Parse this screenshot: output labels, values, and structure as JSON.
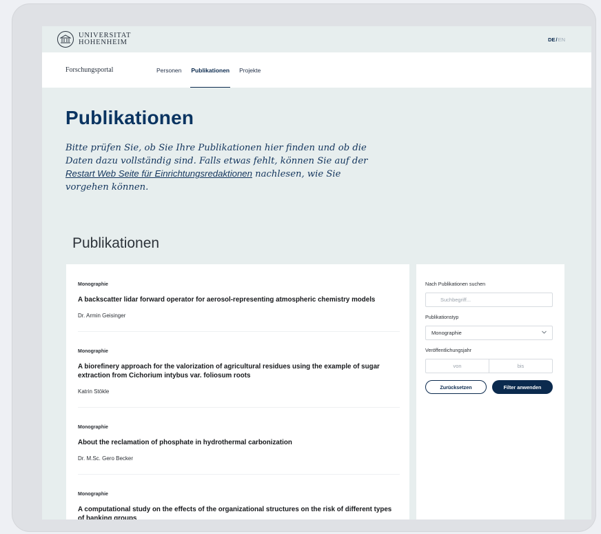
{
  "header": {
    "logo_line1": "UNIVERSITAT",
    "logo_line2": "HOHENHEIM",
    "lang_active": "DE",
    "lang_separator": "/",
    "lang_other": "EN"
  },
  "nav": {
    "portal": "Forschungsportal",
    "tabs": [
      {
        "label": "Personen"
      },
      {
        "label": "Publikationen"
      },
      {
        "label": "Projekte"
      }
    ],
    "active_tab": "Publikationen"
  },
  "hero": {
    "title": "Publikationen",
    "text_before_link": "Bitte prüfen Sie, ob Sie Ihre Publikationen hier finden und ob die Daten dazu vollständig sind. Falls etwas fehlt, können Sie auf der ",
    "link_text": "Restart Web Seite für Einrichtungsredaktionen",
    "text_after_link": " nachlesen, wie Sie vorgehen können."
  },
  "section_title": "Publikationen",
  "publications": [
    {
      "type": "Monographie",
      "title": "A backscatter lidar forward operator for aerosol-representing atmospheric chemistry models",
      "author": "Dr. Armin Geisinger"
    },
    {
      "type": "Monographie",
      "title": "A biorefinery approach for the valorization of agricultural residues using the example of sugar extraction from Cichorium intybus var. foliosum roots",
      "author": "Katrin Stökle"
    },
    {
      "type": "Monographie",
      "title": "About the reclamation of phosphate in hydrothermal carbonization",
      "author": "Dr. M.Sc. Gero Becker"
    },
    {
      "type": "Monographie",
      "title": "A computational study on the effects of the organizational structures on the risk of different types of banking groups",
      "author": ""
    }
  ],
  "filters": {
    "search_label": "Nach Publikationen suchen",
    "search_placeholder": "Suchbegriff...",
    "type_label": "Publikationstyp",
    "type_value": "Monographie",
    "year_label": "Veröffentlichungsjahr",
    "year_from_placeholder": "von",
    "year_to_placeholder": "bis",
    "reset_label": "Zurücksetzen",
    "apply_label": "Filter anwenden"
  },
  "colors": {
    "brand_navy": "#0b2a4e",
    "hero_title": "#0b3461",
    "page_bg": "#e7eeee"
  }
}
